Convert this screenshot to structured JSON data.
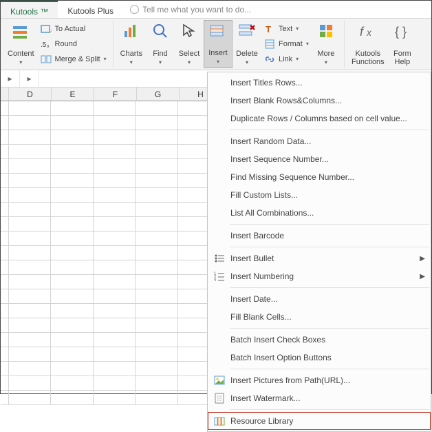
{
  "tabs": {
    "kutools": "Kutools ™",
    "kutools_plus": "Kutools Plus",
    "tellme": "Tell me what you want to do..."
  },
  "ribbon": {
    "content": "Content",
    "to_actual": "To Actual",
    "round": "Round",
    "merge_split": "Merge & Split",
    "charts": "Charts",
    "find": "Find",
    "select": "Select",
    "insert": "Insert",
    "delete": "Delete",
    "text": "Text",
    "format": "Format",
    "link": "Link",
    "more": "More",
    "kutools_functions": "Kutools\nFunctions",
    "formula_helper": "Form\nHelp"
  },
  "columns": [
    "D",
    "E",
    "F",
    "G",
    "H"
  ],
  "menu": {
    "insert_titles_rows": "Insert Titles Rows...",
    "insert_blank_rows_cols": "Insert Blank Rows&Columns...",
    "duplicate_rows_cols": "Duplicate Rows / Columns based on cell value...",
    "insert_random_data": "Insert Random Data...",
    "insert_sequence_number": "Insert Sequence Number...",
    "find_missing_sequence": "Find Missing Sequence Number...",
    "fill_custom_lists": "Fill Custom Lists...",
    "list_all_combinations": "List All Combinations...",
    "insert_barcode": "Insert Barcode",
    "insert_bullet": "Insert Bullet",
    "insert_numbering": "Insert Numbering",
    "insert_date": "Insert Date...",
    "fill_blank_cells": "Fill Blank Cells...",
    "batch_checkboxes": "Batch Insert Check Boxes",
    "batch_option_buttons": "Batch Insert Option Buttons",
    "insert_pictures_url": "Insert Pictures from Path(URL)...",
    "insert_watermark": "Insert Watermark...",
    "resource_library": "Resource Library"
  }
}
